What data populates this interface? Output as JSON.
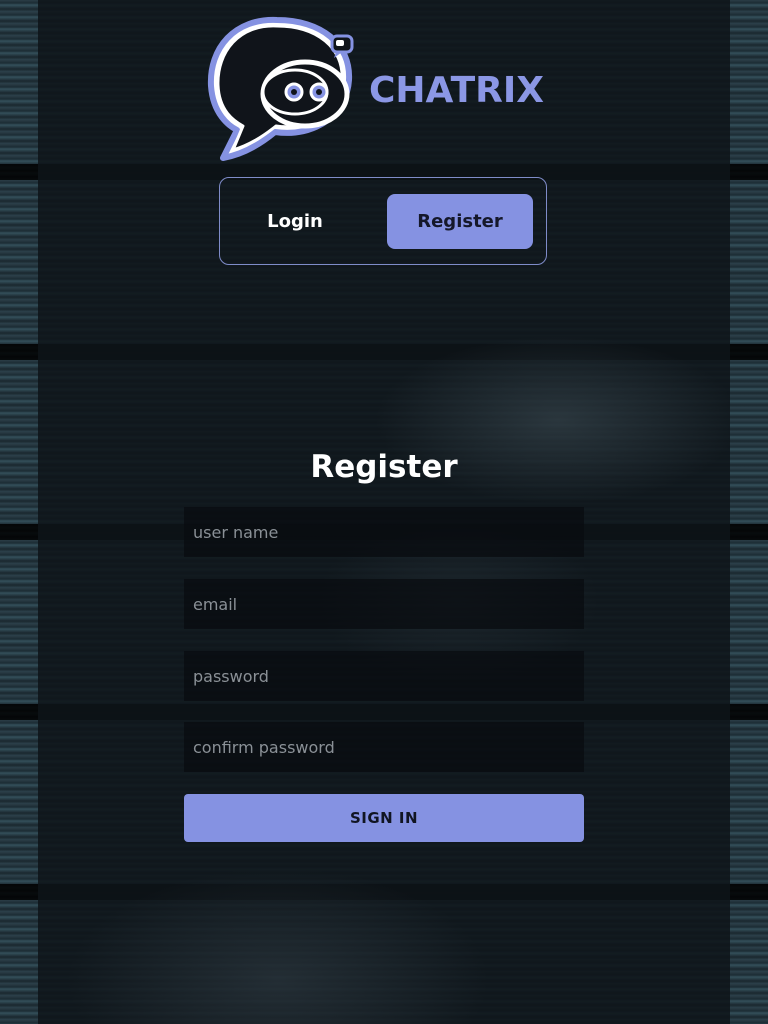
{
  "brand": {
    "name": "CHATRIX",
    "logo_icon": "chat-bubble-mascot-icon",
    "color": "#8b97e5"
  },
  "tabs": [
    {
      "label": "Login",
      "active": false
    },
    {
      "label": "Register",
      "active": true
    }
  ],
  "form": {
    "title": "Register",
    "fields": [
      {
        "name": "username",
        "placeholder": "user name",
        "value": ""
      },
      {
        "name": "email",
        "placeholder": "email",
        "value": ""
      },
      {
        "name": "password",
        "placeholder": "password",
        "value": ""
      },
      {
        "name": "confirm_password",
        "placeholder": "confirm password",
        "value": ""
      }
    ],
    "submit_label": "SIGN IN"
  },
  "colors": {
    "accent": "#8592e2",
    "panel_overlay": "#0e1419",
    "text": "#ffffff"
  }
}
